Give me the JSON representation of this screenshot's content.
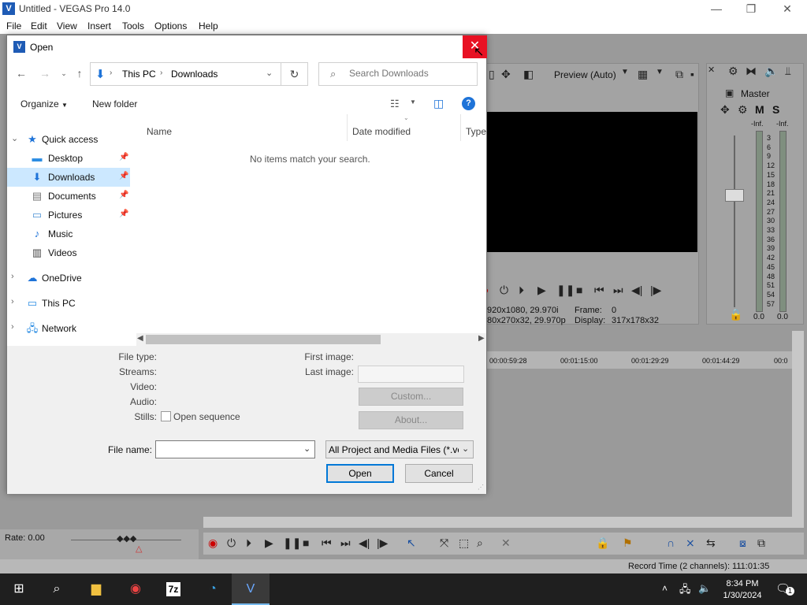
{
  "app": {
    "title": "Untitled - VEGAS Pro 14.0",
    "menu": [
      "File",
      "Edit",
      "View",
      "Insert",
      "Tools",
      "Options",
      "Help"
    ],
    "preview_mode": "Preview (Auto)",
    "master_label": "Master",
    "master_m": "M",
    "master_s": "S",
    "meter_inf_left": "-Inf.",
    "meter_inf_right": "-Inf.",
    "meter_scale": [
      "3",
      "6",
      "9",
      "12",
      "15",
      "18",
      "21",
      "24",
      "27",
      "30",
      "33",
      "36",
      "39",
      "42",
      "45",
      "48",
      "51",
      "54",
      "57"
    ],
    "meter_bottom_left": "0.0",
    "meter_bottom_right": "0.0",
    "video_info_1": "920x1080, 29.970i",
    "video_info_2": "80x270x32, 29.970p",
    "frame_label": "Frame:",
    "frame_value": "0",
    "display_label": "Display:",
    "display_value": "317x178x32",
    "ruler": [
      "00:00:59:28",
      "00:01:15:00",
      "00:01:29:29",
      "00:01:44:29",
      "00:0"
    ],
    "rate": "Rate: 0.00",
    "record_time": "Record Time (2 channels): 111:01:35"
  },
  "dialog": {
    "title": "Open",
    "close_glyph": "✕",
    "breadcrumb": [
      "This PC",
      "Downloads"
    ],
    "search_placeholder": "Search Downloads",
    "organize": "Organize",
    "new_folder": "New folder",
    "help_glyph": "?",
    "nav": {
      "quick_access": "Quick access",
      "desktop": "Desktop",
      "downloads": "Downloads",
      "documents": "Documents",
      "pictures": "Pictures",
      "music": "Music",
      "videos": "Videos",
      "onedrive": "OneDrive",
      "this_pc": "This PC",
      "network": "Network"
    },
    "columns": {
      "name": "Name",
      "date": "Date modified",
      "type": "Type"
    },
    "empty_message": "No items match your search.",
    "info": {
      "file_type": "File type:",
      "streams": "Streams:",
      "video": "Video:",
      "audio": "Audio:",
      "stills": "Stills:",
      "first_image": "First image:",
      "last_image": "Last image:",
      "open_sequence": "Open sequence"
    },
    "custom_button": "Custom...",
    "about_button": "About...",
    "file_name_label": "File name:",
    "file_name_value": "",
    "file_type_value": "All Project and Media Files (*.ve",
    "open_button": "Open",
    "cancel_button": "Cancel"
  },
  "taskbar": {
    "time": "8:34 PM",
    "date": "1/30/2024",
    "notification_count": "1",
    "seven_zip": "7z"
  }
}
